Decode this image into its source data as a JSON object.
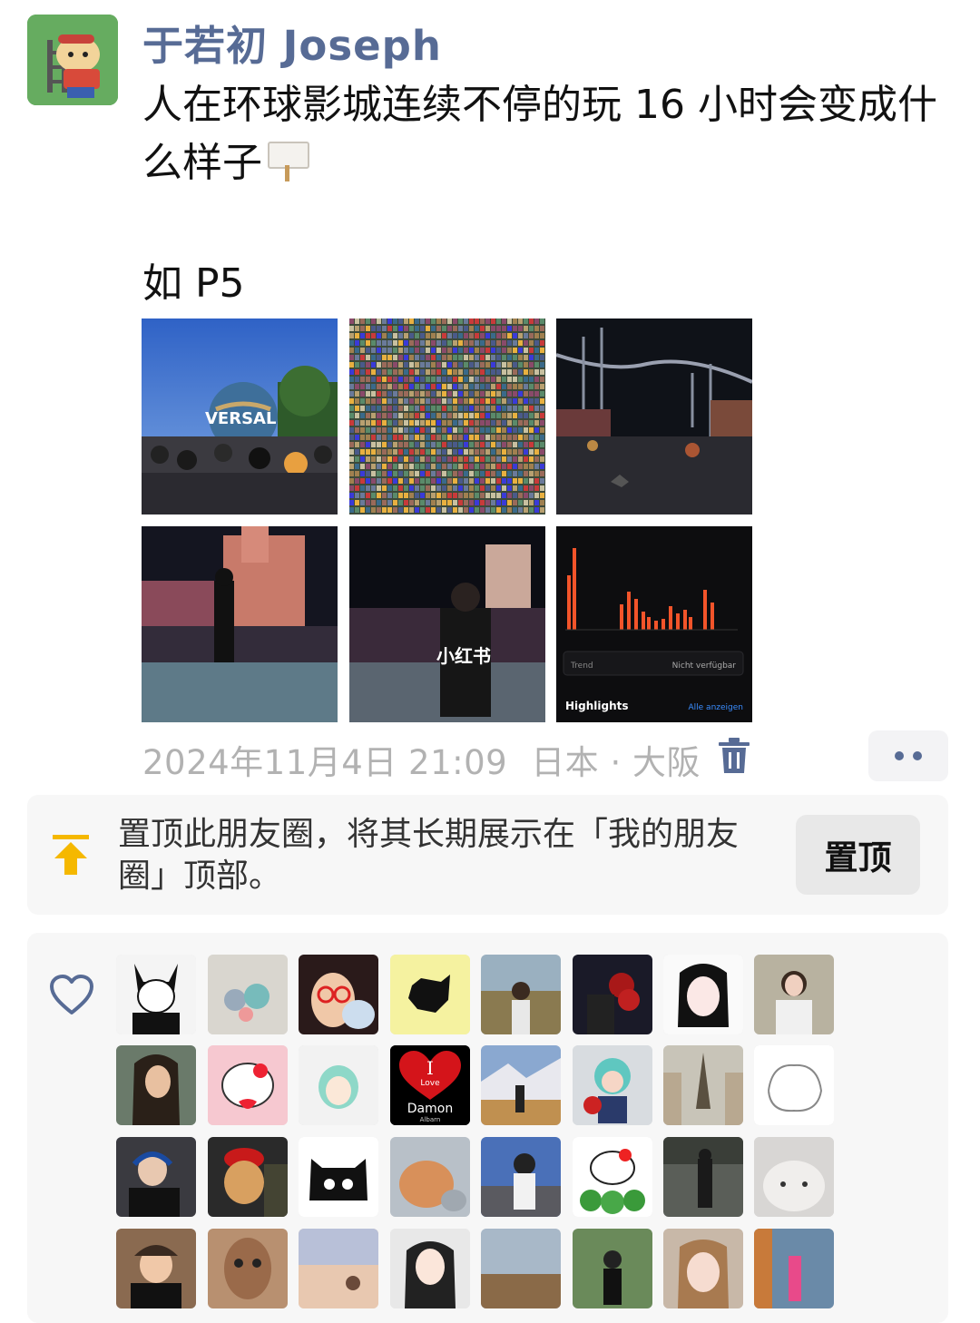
{
  "post": {
    "author": "于若初 Joseph",
    "text_line1": "人在环球影城连续不停的玩 16 小时会变成什",
    "text_line2": "么样子",
    "text_line3": "如 P5",
    "sign_emoji": "sign-emoji",
    "photos": [
      {
        "name": "universal-globe-photo",
        "overlay": "VERSAL"
      },
      {
        "name": "crowd-mosaic-photo"
      },
      {
        "name": "night-rollercoaster-photo"
      },
      {
        "name": "night-street-photo"
      },
      {
        "name": "night-portrait-photo",
        "watermark": "小红书"
      },
      {
        "name": "step-chart-screenshot",
        "trend_label": "Trend",
        "trend_value": "Nicht verfügbar",
        "highlights": "Highlights",
        "highlights_link": "Alle anzeigen"
      }
    ],
    "date": "2024年11月4日 21:09",
    "location": "日本 · 大阪",
    "trash_icon": "trash-icon",
    "more_icon": "more-icon"
  },
  "pin": {
    "icon": "pin-top-icon",
    "text": "置顶此朋友圈，将其长期展示在「我的朋友圈」顶部。",
    "button": "置顶",
    "accent": "#f5b800"
  },
  "likes": {
    "icon": "heart-icon",
    "love_tile": {
      "big": "I",
      "small": "Love",
      "name": "Damon",
      "sub": "Albarn"
    }
  },
  "colors": {
    "link": "#576b95",
    "meta": "#b2b2b2",
    "panel": "#f7f7f7"
  }
}
